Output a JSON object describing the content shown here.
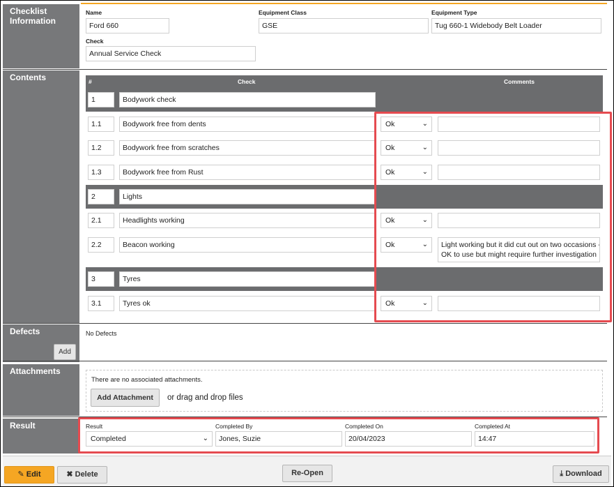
{
  "sections": {
    "checklist_info": "Checklist Information",
    "contents": "Contents",
    "defects": "Defects",
    "attachments": "Attachments",
    "result": "Result"
  },
  "info": {
    "name_label": "Name",
    "name_value": "Ford 660",
    "equipment_class_label": "Equipment Class",
    "equipment_class_value": "GSE",
    "equipment_type_label": "Equipment Type",
    "equipment_type_value": "Tug 660-1 Widebody Belt Loader",
    "check_label": "Check",
    "check_value": "Annual Service Check"
  },
  "contents": {
    "col_num": "#",
    "col_check": "Check",
    "col_comments": "Comments",
    "groups": [
      {
        "num": "1",
        "title": "Bodywork check",
        "items": [
          {
            "num": "1.1",
            "check": "Bodywork free from dents",
            "status": "Ok",
            "comment": ""
          },
          {
            "num": "1.2",
            "check": "Bodywork free from scratches",
            "status": "Ok",
            "comment": ""
          },
          {
            "num": "1.3",
            "check": "Bodywork free from Rust",
            "status": "Ok",
            "comment": ""
          }
        ]
      },
      {
        "num": "2",
        "title": "Lights",
        "items": [
          {
            "num": "2.1",
            "check": "Headlights working",
            "status": "Ok",
            "comment": ""
          },
          {
            "num": "2.2",
            "check": "Beacon working",
            "status": "Ok",
            "comment_line1": "Light working but it did cut out on two occasions -",
            "comment_line2": "OK to use but might require further investigation"
          }
        ]
      },
      {
        "num": "3",
        "title": "Tyres",
        "items": [
          {
            "num": "3.1",
            "check": "Tyres ok",
            "status": "Ok",
            "comment": ""
          }
        ]
      }
    ]
  },
  "defects": {
    "empty_text": "No Defects",
    "add_label": "Add"
  },
  "attachments": {
    "empty_text": "There are no associated attachments.",
    "add_label": "Add Attachment",
    "drag_text": "or drag and drop files"
  },
  "result": {
    "result_label": "Result",
    "result_value": "Completed",
    "completed_by_label": "Completed By",
    "completed_by_value": "Jones, Suzie",
    "completed_on_label": "Completed On",
    "completed_on_value": "20/04/2023",
    "completed_at_label": "Completed At",
    "completed_at_value": "14:47"
  },
  "toolbar": {
    "edit_label": "Edit",
    "delete_label": "Delete",
    "reopen_label": "Re-Open",
    "download_label": "Download"
  },
  "colors": {
    "accent": "#f5a623",
    "highlight": "#e54b50",
    "header_gray": "#6b6c6e"
  },
  "icons": {
    "edit": "edit-icon",
    "delete": "close-icon",
    "download": "download-icon",
    "dropdown": "chevron-down-icon"
  }
}
